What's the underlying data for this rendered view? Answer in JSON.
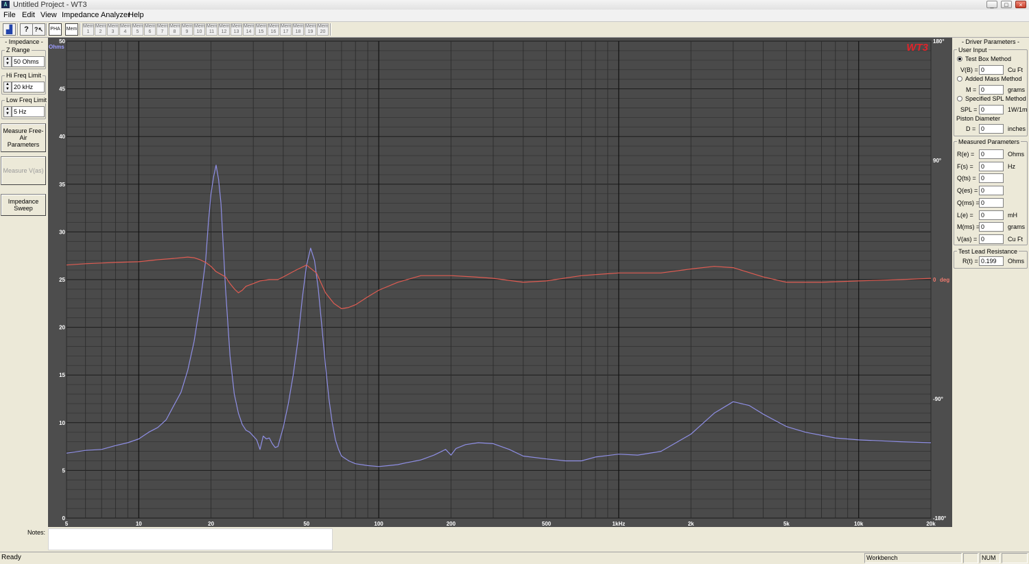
{
  "window": {
    "title": "Untitled Project - WT3",
    "icon": "wt3-app-icon",
    "min": "_",
    "max": "□",
    "close": "×"
  },
  "menu": [
    "File",
    "Edit",
    "View",
    "Impedance Analyzer",
    "Help"
  ],
  "toolbar": {
    "buttons": [
      {
        "name": "chart-icon",
        "label": "▟"
      },
      {
        "name": "help-icon",
        "label": "?"
      },
      {
        "name": "context-help-icon",
        "label": "?↖"
      },
      {
        "name": "pha-button",
        "label": "PHA"
      },
      {
        "name": "mem-button",
        "label": "Mem"
      }
    ],
    "memory_slots": [
      "1",
      "2",
      "3",
      "4",
      "5",
      "6",
      "7",
      "8",
      "9",
      "10",
      "11",
      "12",
      "13",
      "14",
      "15",
      "16",
      "17",
      "18",
      "19",
      "20"
    ],
    "memory_prefix": "Mem"
  },
  "left_panel": {
    "title": "- Impedance -",
    "z_range": {
      "label": "Z Range",
      "value": "50 Ohms"
    },
    "hi_freq": {
      "label": "Hi Freq Limit",
      "value": "20 kHz"
    },
    "low_freq": {
      "label": "Low Freq Limit",
      "value": "5 Hz"
    },
    "buttons": {
      "free_air": "Measure Free-Air Parameters",
      "vas": "Measure V(as)",
      "sweep": "Impedance Sweep"
    }
  },
  "chart_data": {
    "type": "line",
    "xscale": "log",
    "xlim": [
      5,
      20000
    ],
    "ylim": [
      0,
      50
    ],
    "y2lim": [
      -180,
      180
    ],
    "grid": true,
    "logo": "WT3",
    "y_unit_label": "Ohms",
    "y2_unit_label": "deg",
    "x_ticks": [
      {
        "v": 5,
        "label": "5"
      },
      {
        "v": 10,
        "label": "10"
      },
      {
        "v": 20,
        "label": "20"
      },
      {
        "v": 50,
        "label": "50"
      },
      {
        "v": 100,
        "label": "100"
      },
      {
        "v": 200,
        "label": "200"
      },
      {
        "v": 500,
        "label": "500"
      },
      {
        "v": 1000,
        "label": "1kHz"
      },
      {
        "v": 2000,
        "label": "2k"
      },
      {
        "v": 5000,
        "label": "5k"
      },
      {
        "v": 10000,
        "label": "10k"
      },
      {
        "v": 20000,
        "label": "20k"
      }
    ],
    "y_ticks": [
      "0",
      "5",
      "10",
      "15",
      "20",
      "25",
      "30",
      "35",
      "40",
      "45",
      "50"
    ],
    "y2_ticks": [
      {
        "v": 180,
        "label": "180°"
      },
      {
        "v": 90,
        "label": "90°"
      },
      {
        "v": 0,
        "label": "0"
      },
      {
        "v": -90,
        "label": "-90°"
      },
      {
        "v": -180,
        "label": "-180°"
      }
    ],
    "series": [
      {
        "role": "impedance",
        "axis": "y",
        "color": "#8f8fe6",
        "x": [
          5,
          6,
          7,
          8,
          9,
          10,
          11,
          12,
          13,
          14,
          15,
          16,
          17,
          18,
          19,
          19.5,
          20,
          20.5,
          21,
          21.5,
          22,
          23,
          24,
          25,
          26,
          27,
          28,
          29,
          30,
          31,
          32,
          33,
          34,
          35,
          36,
          37,
          38,
          40,
          42,
          44,
          46,
          48,
          50,
          52,
          54,
          56,
          58,
          60,
          62,
          64,
          66,
          68,
          70,
          75,
          80,
          90,
          100,
          110,
          120,
          130,
          150,
          170,
          190,
          200,
          210,
          230,
          260,
          300,
          350,
          400,
          500,
          600,
          700,
          800,
          1000,
          1200,
          1500,
          2000,
          2500,
          3000,
          3500,
          4000,
          5000,
          6000,
          8000,
          10000,
          15000,
          20000
        ],
        "y": [
          6.8,
          7.1,
          7.2,
          7.6,
          7.9,
          8.3,
          9.0,
          9.5,
          10.3,
          11.8,
          13.2,
          15.5,
          18.5,
          22.5,
          27,
          31,
          34,
          35.8,
          37,
          35.5,
          33,
          24,
          17,
          13,
          11,
          9.8,
          9.2,
          9.0,
          8.6,
          8.2,
          7.2,
          8.6,
          8.3,
          8.4,
          7.8,
          7.4,
          7.5,
          9.5,
          12,
          15,
          18.5,
          23,
          26.5,
          28.3,
          27,
          24,
          20,
          16,
          12.5,
          10,
          8.2,
          7.2,
          6.5,
          6.0,
          5.7,
          5.5,
          5.4,
          5.5,
          5.6,
          5.8,
          6.1,
          6.6,
          7.2,
          6.6,
          7.3,
          7.7,
          7.9,
          7.8,
          7.2,
          6.5,
          6.2,
          6.0,
          6.0,
          6.4,
          6.7,
          6.6,
          7.0,
          8.8,
          11.0,
          12.2,
          11.8,
          10.9,
          9.6,
          9.0,
          8.4,
          8.2,
          8.0,
          7.9
        ]
      },
      {
        "role": "phase",
        "axis": "y2",
        "color": "#e05c52",
        "x": [
          5,
          6,
          7,
          8,
          10,
          12,
          14,
          16,
          17,
          18,
          19,
          20,
          21,
          22,
          23,
          24,
          25,
          26,
          27,
          28,
          30,
          32,
          35,
          38,
          40,
          45,
          50,
          55,
          60,
          65,
          70,
          75,
          80,
          90,
          100,
          120,
          150,
          200,
          250,
          300,
          400,
          500,
          700,
          1000,
          1500,
          2000,
          2500,
          3000,
          4000,
          5000,
          7000,
          10000,
          15000,
          20000
        ],
        "y": [
          11,
          12,
          12.5,
          13,
          13.5,
          15,
          16,
          17,
          16.5,
          15,
          13,
          10,
          6,
          4,
          2,
          -3,
          -7,
          -10,
          -8,
          -5,
          -3,
          -1,
          0,
          0,
          2,
          7,
          11,
          5,
          -10,
          -18,
          -22,
          -21,
          -19,
          -13,
          -8,
          -2,
          3,
          3,
          2,
          1,
          -2,
          -1,
          3,
          5,
          5,
          8,
          10,
          9,
          2,
          -2,
          -2,
          -1,
          0,
          1
        ]
      }
    ]
  },
  "driver_params": {
    "title": "- Driver Parameters -",
    "user_input": {
      "label": "User Input",
      "test_box": {
        "label": "Test Box Method",
        "field": "V(B) =",
        "value": "0",
        "unit": "Cu Ft",
        "selected": true
      },
      "added_mass": {
        "label": "Added Mass Method",
        "field": "M =",
        "value": "0",
        "unit": "grams"
      },
      "spl": {
        "label": "Specified SPL Method",
        "field": "SPL =",
        "value": "0",
        "unit": "1W/1m"
      },
      "piston": {
        "label": "Piston Diameter",
        "field": "D =",
        "value": "0",
        "unit": "inches"
      }
    },
    "measured": {
      "label": "Measured Parameters",
      "rows": [
        {
          "label": "R(e) =",
          "value": "0",
          "unit": "Ohms"
        },
        {
          "label": "F(s) =",
          "value": "0",
          "unit": "Hz"
        },
        {
          "label": "Q(ts) =",
          "value": "0",
          "unit": ""
        },
        {
          "label": "Q(es) =",
          "value": "0",
          "unit": ""
        },
        {
          "label": "Q(ms) =",
          "value": "0",
          "unit": ""
        },
        {
          "label": "L(e) =",
          "value": "0",
          "unit": "mH"
        },
        {
          "label": "M(ms) =",
          "value": "0",
          "unit": "grams"
        },
        {
          "label": "V(as) =",
          "value": "0",
          "unit": "Cu Ft"
        }
      ]
    },
    "lead": {
      "label": "Test Lead Resistance",
      "field": "R(t) =",
      "value": "0.199",
      "unit": "Ohms"
    }
  },
  "notes": {
    "label": "Notes:"
  },
  "status": {
    "text": "Ready",
    "workbench": "Workbench",
    "num": "NUM"
  }
}
